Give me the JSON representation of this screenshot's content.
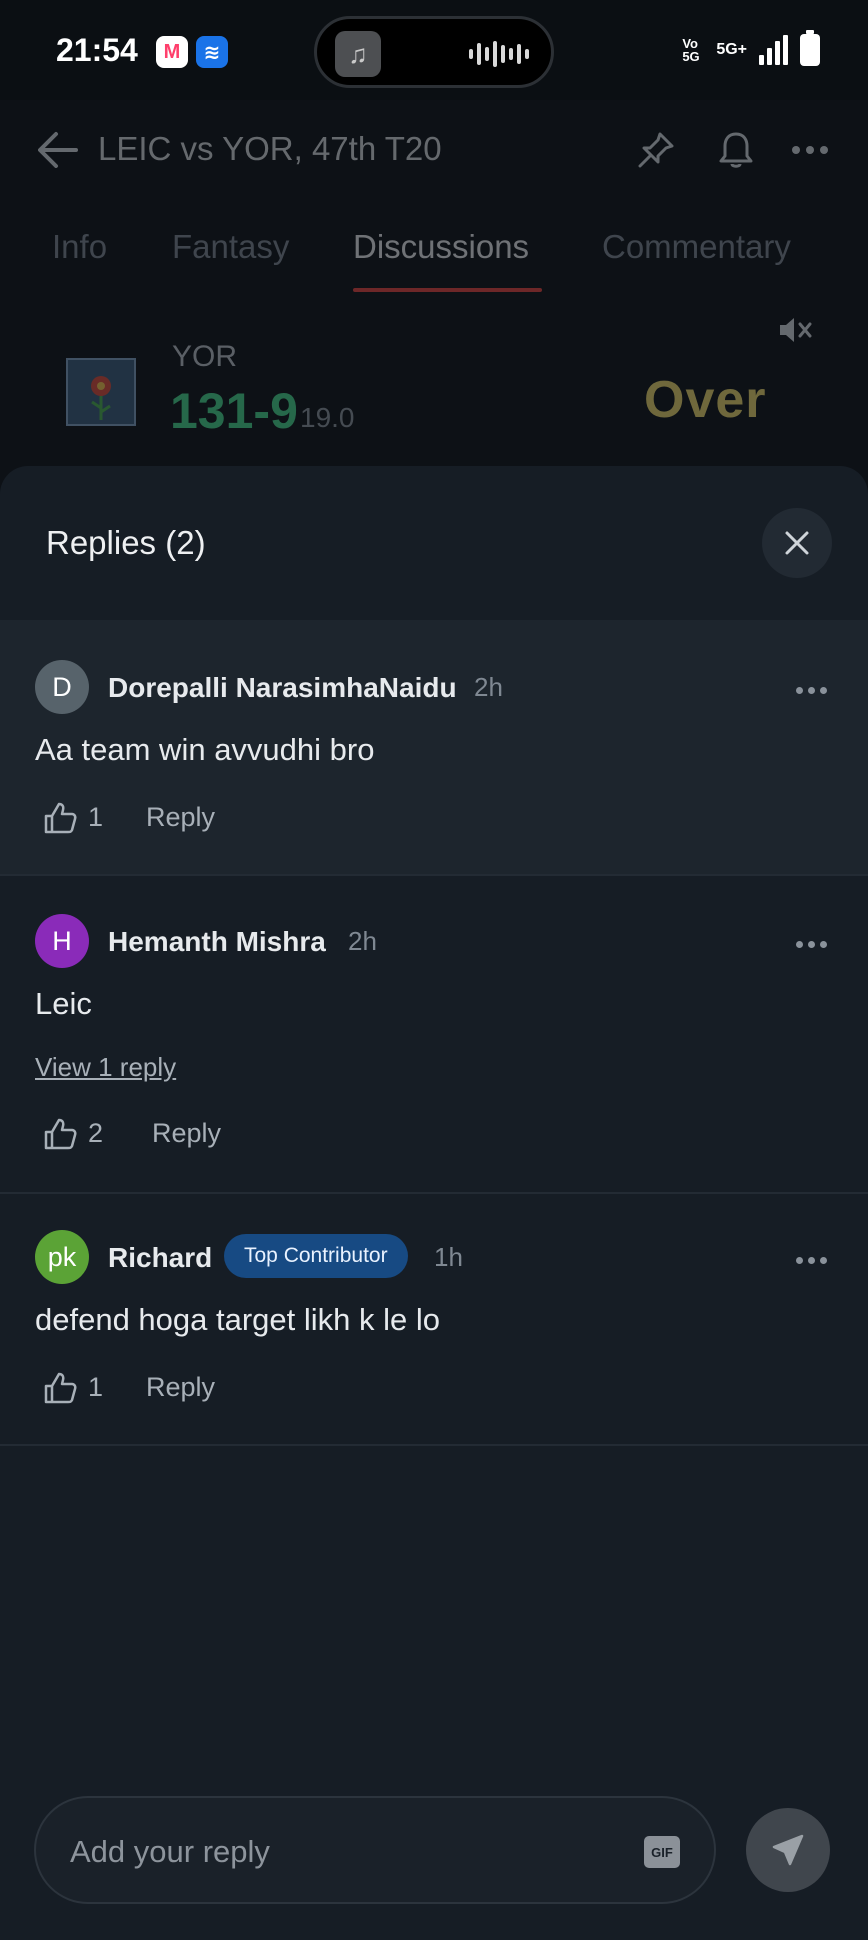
{
  "status_bar": {
    "time": "21:54",
    "app_badge_1": "M",
    "app_badge_2": "≋",
    "network_label": "5G+",
    "volte_label": "Vo 5G"
  },
  "header": {
    "title": "LEIC vs YOR, 47th T20"
  },
  "tabs": [
    {
      "label": "Info"
    },
    {
      "label": "Fantasy"
    },
    {
      "label": "Discussions"
    },
    {
      "label": "Commentary"
    }
  ],
  "score": {
    "team": "YOR",
    "runs": "131-9",
    "overs": "19.0",
    "status": "Over"
  },
  "sheet": {
    "title": "Replies (2)"
  },
  "comments": [
    {
      "initial": "D",
      "name": "Dorepalli NarasimhaNaidu",
      "time": "2h",
      "text": "Aa team win avvudhi bro",
      "likes": "1",
      "reply_label": "Reply",
      "avatar_color": "#57636b"
    },
    {
      "initial": "H",
      "name": "Hemanth Mishra",
      "time": "2h",
      "text": "Leic",
      "view_replies": "View 1 reply",
      "likes": "2",
      "reply_label": "Reply",
      "avatar_color": "#8a2bb9"
    },
    {
      "initial": "pk",
      "name": "Richard",
      "badge": "Top Contributor",
      "time": "1h",
      "text": "defend hoga target likh k le lo",
      "likes": "1",
      "reply_label": "Reply",
      "avatar_color": "#5ba336"
    }
  ],
  "composer": {
    "placeholder": "Add your reply",
    "gif_label": "GIF"
  },
  "colors": {
    "accent_underline": "#e2433e",
    "score_green": "#46d38a",
    "over_yellow": "#e6d36a",
    "badge_blue": "#174a83"
  }
}
